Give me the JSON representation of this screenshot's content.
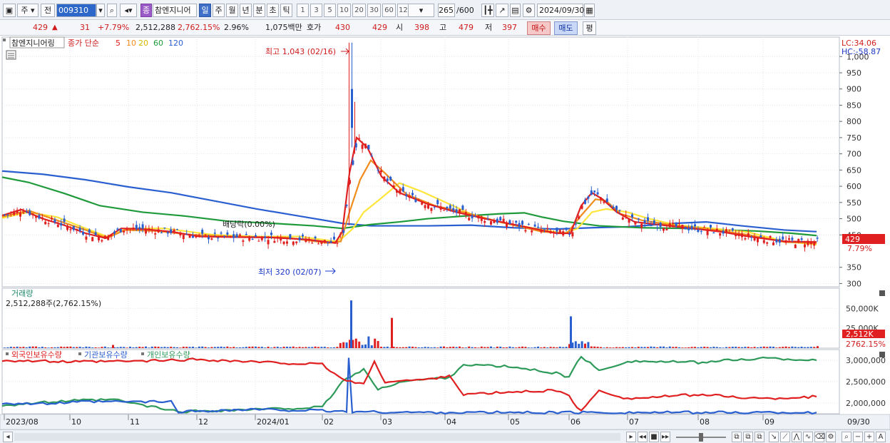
{
  "toolbar": {
    "market": "주",
    "jeon": "전",
    "code": "009310",
    "name_badge": "종",
    "name": "참엔지니어",
    "periods": [
      "일",
      "주",
      "월",
      "년",
      "분",
      "초",
      "틱"
    ],
    "minutes": [
      "1",
      "3",
      "5",
      "10",
      "20",
      "30",
      "60",
      "120"
    ],
    "count": "265",
    "count_total": "/600",
    "date": "2024/09/30"
  },
  "quote": {
    "price": "429",
    "change": "31",
    "change_pct": "+7.79%",
    "volume": "2,512,288",
    "volume_pct": "2,762.15%",
    "turnover_pct": "2.96%",
    "amount": "1,075백만",
    "hoga_label": "호가",
    "ask": "430",
    "bid": "429",
    "open_label": "시",
    "open": "398",
    "high_label": "고",
    "high": "479",
    "low_label": "저",
    "low": "397",
    "buy_button": "매수",
    "sell_button": "매도",
    "avg_button": "평"
  },
  "price_panel": {
    "legend_name": "참엔지니어링",
    "legend_type": "종가 단순",
    "ma_labels": [
      "5",
      "10",
      "20",
      "60",
      "120"
    ],
    "lc": "LC:34.06",
    "hc": "HC:-58.87",
    "high_note": "최고 1,043 (02/16)",
    "low_note": "최저 320 (02/07)",
    "dividend_note": "배당락(0.00%)",
    "last_price_tag": "429",
    "last_pct_tag": "7.79%",
    "yticks": [
      "1,000",
      "950",
      "900",
      "850",
      "800",
      "750",
      "700",
      "650",
      "600",
      "550",
      "500",
      "450",
      "350",
      "300"
    ]
  },
  "volume_panel": {
    "title": "거래량",
    "value": "2,512,288주(2,762.15%)",
    "yticks": [
      "50,000K",
      "25,000K"
    ],
    "last_tag": "2,512K",
    "last_pct": "2762.15%"
  },
  "holdings_panel": {
    "legend": [
      "외국인보유수량",
      "기관보유수량",
      "개인보유수량"
    ],
    "yticks": [
      "3,000,000",
      "2,500,000",
      "2,000,000"
    ]
  },
  "xaxis": [
    "2023/08",
    "10",
    "11",
    "12",
    "2024/01",
    "02",
    "03",
    "04",
    "05",
    "06",
    "07",
    "08",
    "09",
    "09/30"
  ],
  "colors": {
    "up": "#e02020",
    "down": "#2a5fd0",
    "ma5": "#e02020",
    "ma10": "#f08c1c",
    "ma20": "#ffe43a",
    "ma60": "#1f9a3a",
    "ma120": "#2a5fd0",
    "foreign": "#e02020",
    "institution": "#2a5fd0",
    "individual": "#2e9a5a"
  },
  "chart_data": [
    {
      "type": "candlestick+line",
      "title": "참엔지니어링 종가 단순",
      "x": [
        "2023/08",
        "2023/09",
        "2023/10",
        "2023/11",
        "2023/12",
        "2024/01",
        "2024/02-07",
        "2024/02-16",
        "2024/03",
        "2024/04",
        "2024/05",
        "2024/06",
        "2024/07",
        "2024/08",
        "2024/09",
        "2024/09/30"
      ],
      "series": [
        {
          "name": "close",
          "values": [
            510,
            495,
            440,
            455,
            420,
            410,
            320,
            1043,
            560,
            490,
            420,
            620,
            475,
            440,
            405,
            429
          ]
        },
        {
          "name": "120",
          "values": [
            645,
            630,
            590,
            560,
            535,
            510,
            483,
            480,
            480,
            470,
            465,
            470,
            480,
            490,
            460,
            445
          ]
        },
        {
          "name": "60",
          "values": [
            625,
            590,
            520,
            475,
            460,
            445,
            465,
            490,
            505,
            505,
            510,
            480,
            475,
            470,
            450,
            430
          ]
        }
      ],
      "ylim": [
        290,
        1060
      ],
      "annotations": [
        "최고 1,043 (02/16)",
        "최저 320 (02/07)",
        "배당락(0.00%)"
      ]
    },
    {
      "type": "bar",
      "title": "거래량",
      "ylabel": "K",
      "x": [
        "2023/10",
        "2024/02-16",
        "2024/02-20",
        "2024/06-03",
        "2024/09/30"
      ],
      "values": [
        4000,
        60000,
        38000,
        40000,
        2512
      ]
    },
    {
      "type": "line",
      "title": "보유수량",
      "x": [
        "2023/08",
        "2023/10",
        "2023/12",
        "2024/02",
        "2024/03",
        "2024/04",
        "2024/05",
        "2024/06",
        "2024/07",
        "2024/08",
        "2024/09"
      ],
      "series": [
        {
          "name": "외국인보유수량",
          "values": [
            3000000,
            2950000,
            3050000,
            2950000,
            2500000,
            2550000,
            2200000,
            2300000,
            2200000,
            2200000,
            2150000
          ]
        },
        {
          "name": "기관보유수량",
          "values": [
            2000000,
            2000000,
            1750000,
            1800000,
            1780000,
            1770000,
            1770000,
            1780000,
            1780000,
            1780000,
            1780000
          ]
        },
        {
          "name": "개인보유수량",
          "values": [
            2000000,
            2050000,
            1800000,
            1900000,
            2500000,
            2650000,
            2750000,
            3100000,
            3000000,
            2950000,
            3000000
          ]
        }
      ],
      "ylim": [
        1750000,
        3250000
      ]
    }
  ]
}
